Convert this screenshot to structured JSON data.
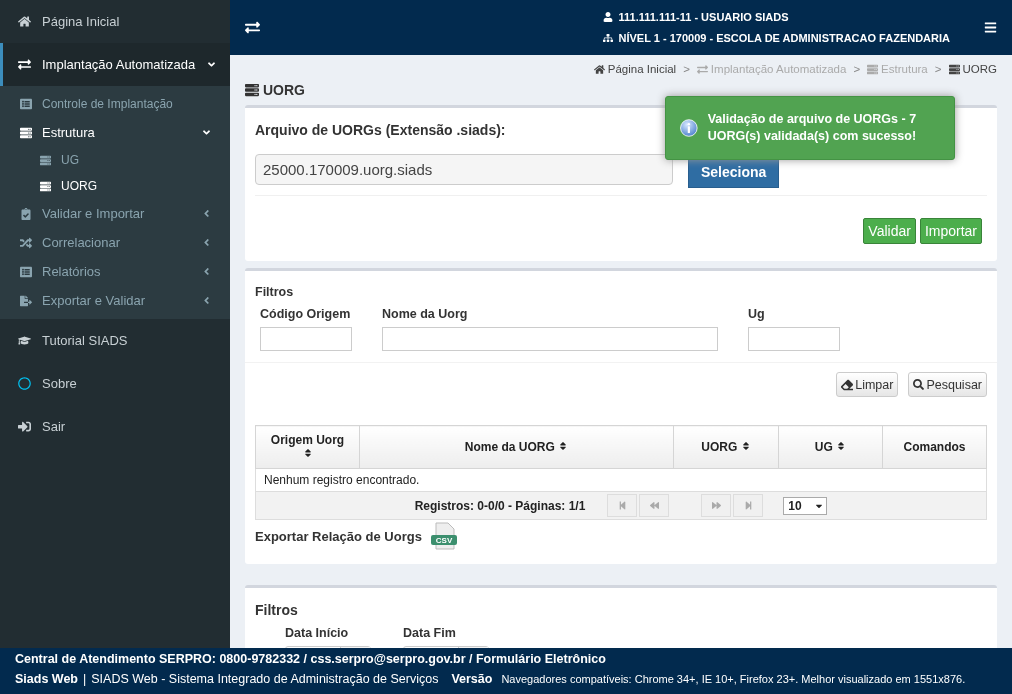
{
  "sidebar": {
    "items": [
      {
        "label": "Página Inicial",
        "selected": false
      },
      {
        "label": "Implantação Automatizada",
        "selected": true,
        "expanded": true,
        "children": [
          {
            "label": "Controle de Implantação",
            "selected": false
          },
          {
            "label": "Estrutura",
            "selected": true,
            "expanded": true,
            "children": [
              {
                "label": "UG",
                "selected": false
              },
              {
                "label": "UORG",
                "selected": true
              }
            ]
          },
          {
            "label": "Validar e Importar",
            "selected": false,
            "expanded": false
          },
          {
            "label": "Correlacionar",
            "selected": false,
            "expanded": false
          },
          {
            "label": "Relatórios",
            "selected": false,
            "expanded": false
          },
          {
            "label": "Exportar e Validar",
            "selected": false,
            "expanded": false
          }
        ]
      },
      {
        "label": "Tutorial SIADS",
        "selected": false
      },
      {
        "label": "Sobre",
        "selected": false
      },
      {
        "label": "Sair",
        "selected": false
      }
    ]
  },
  "header": {
    "user": "111.111.111-11 - USUARIO SIADS",
    "level": "NÍVEL 1 - 170009 - ESCOLA DE ADMINISTRACAO FAZENDARIA"
  },
  "page_title": "UORG",
  "breadcrumb": [
    {
      "label": "Página Inicial",
      "disabled": false
    },
    {
      "separator": ">",
      "label": "Implantação Automatizada",
      "disabled": true
    },
    {
      "separator": ">",
      "label": "Estrutura",
      "disabled": true
    },
    {
      "separator": ">",
      "label": "UORG",
      "disabled": false
    }
  ],
  "upload": {
    "label": "Arquivo de UORGs (Extensão .siads):",
    "file": "25000.170009.uorg.siads",
    "select_button": "Seleciona",
    "buttons": [
      "Validar",
      "Importar"
    ]
  },
  "toast": {
    "message": "Validação de arquivo de UORGs - 7 UORG(s) validada(s) com sucesso!"
  },
  "filters": {
    "title": "Filtros",
    "fields": [
      {
        "label": "Código Origem"
      },
      {
        "label": "Nome da Uorg"
      },
      {
        "label": "Ug"
      }
    ],
    "buttons": [
      "Limpar",
      "Pesquisar"
    ]
  },
  "table": {
    "columns": [
      {
        "label": "Origem Uorg",
        "sortable": true
      },
      {
        "label": "Nome da UORG",
        "sortable": true
      },
      {
        "label": "UORG",
        "sortable": true
      },
      {
        "label": "UG",
        "sortable": true
      },
      {
        "label": "Comandos",
        "sortable": false
      }
    ],
    "empty": "Nenhum registro encontrado.",
    "summary": "Registros: 0-0/0 - Páginas: 1/1",
    "page_size": "10"
  },
  "export": {
    "label": "Exportar Relação de Uorgs",
    "icon_text": "CSV"
  },
  "filters2": {
    "title": "Filtros",
    "fields": [
      {
        "label": "Data Início"
      },
      {
        "label": "Data Fim"
      }
    ]
  },
  "footer": {
    "contact": "Central de Atendimento SERPRO: 0800-9782332 / css.serpro@serpro.gov.br / Formulário Eletrônico",
    "app": "Siads Web",
    "separator": "|",
    "description": "SIADS Web - Sistema Integrado de Administração de Serviços",
    "version_label": "Versão",
    "browsers": "Navegadores compatíveis: Chrome 34+, IE 10+, Firefox 23+. Melhor visualizado em 1551x876."
  }
}
